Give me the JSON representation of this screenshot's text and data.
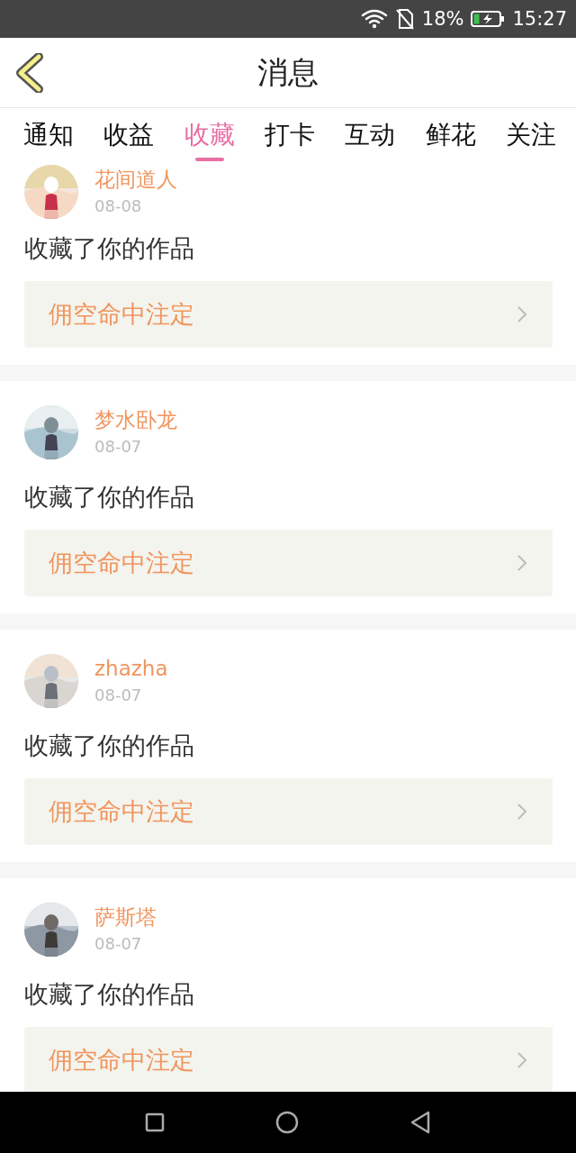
{
  "status_bar": {
    "battery_percent": "18%",
    "time": "15:27"
  },
  "header": {
    "title": "消息"
  },
  "tabs": [
    {
      "label": "通知",
      "selected": false
    },
    {
      "label": "收益",
      "selected": false
    },
    {
      "label": "收藏",
      "selected": true
    },
    {
      "label": "打卡",
      "selected": false
    },
    {
      "label": "互动",
      "selected": false
    },
    {
      "label": "鲜花",
      "selected": false
    },
    {
      "label": "关注",
      "selected": false
    }
  ],
  "messages": [
    {
      "name": "花间道人",
      "date": "08-08",
      "action": "收藏了你的作品",
      "work": "佣空命中注定"
    },
    {
      "name": "梦水卧龙",
      "date": "08-07",
      "action": "收藏了你的作品",
      "work": "佣空命中注定"
    },
    {
      "name": "zhazha",
      "date": "08-07",
      "action": "收藏了你的作品",
      "work": "佣空命中注定"
    },
    {
      "name": "萨斯塔",
      "date": "08-07",
      "action": "收藏了你的作品",
      "work": "佣空命中注定"
    }
  ]
}
